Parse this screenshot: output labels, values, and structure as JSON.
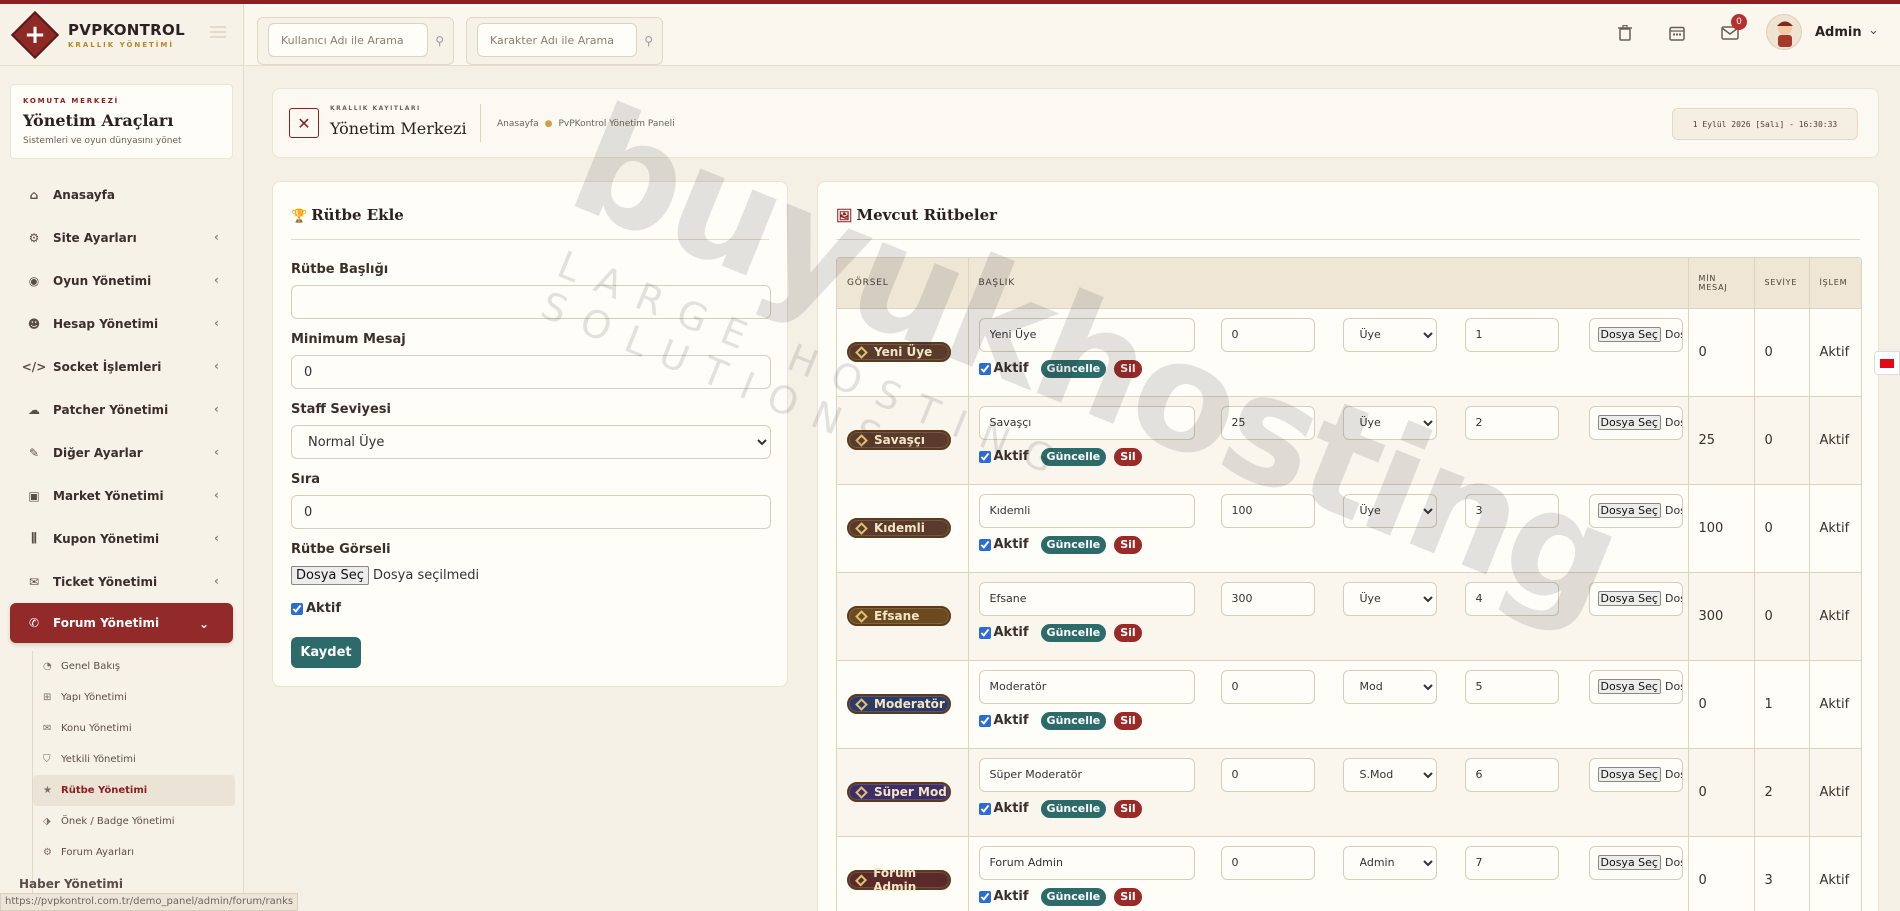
{
  "brand": {
    "name": "PVPKONTROL",
    "sub": "KRALLIK YÖNETİMİ"
  },
  "topbar": {
    "search_user_placeholder": "Kullanıcı Adı ile Arama",
    "search_char_placeholder": "Karakter Adı ile Arama",
    "mail_badge": "0",
    "admin_name": "Admin"
  },
  "sidebar": {
    "kicker": "KOMUTA MERKEZİ",
    "title": "Yönetim Araçları",
    "desc": "Sistemleri ve oyun dünyasını yönet",
    "items": [
      {
        "label": "Anasayfa",
        "icon": "home-icon"
      },
      {
        "label": "Site Ayarları",
        "icon": "gear-icon"
      },
      {
        "label": "Oyun Yönetimi",
        "icon": "gamepad-icon"
      },
      {
        "label": "Hesap Yönetimi",
        "icon": "users-icon"
      },
      {
        "label": "Socket İşlemleri",
        "icon": "code-icon"
      },
      {
        "label": "Patcher Yönetimi",
        "icon": "cloud-icon"
      },
      {
        "label": "Diğer Ayarlar",
        "icon": "wrench-icon"
      },
      {
        "label": "Market Yönetimi",
        "icon": "cart-icon"
      },
      {
        "label": "Kupon Yönetimi",
        "icon": "barcode-icon"
      },
      {
        "label": "Ticket Yönetimi",
        "icon": "ticket-icon"
      },
      {
        "label": "Forum Yönetimi",
        "icon": "comments-icon"
      }
    ],
    "sub_items": [
      {
        "label": "Genel Bakış",
        "icon": "gauge-icon"
      },
      {
        "label": "Yapı Yönetimi",
        "icon": "sitemap-icon"
      },
      {
        "label": "Konu Yönetimi",
        "icon": "comment-icon"
      },
      {
        "label": "Yetkili Yönetimi",
        "icon": "shield-icon"
      },
      {
        "label": "Rütbe Yönetimi",
        "icon": "star-icon"
      },
      {
        "label": "Önek / Badge Yönetimi",
        "icon": "tags-icon"
      },
      {
        "label": "Forum Ayarları",
        "icon": "cogs-icon"
      }
    ],
    "status_url": "https://pvpkontrol.com.tr/demo_panel/admin/forum/ranks",
    "next_item_partial": "Haber Yönetimi"
  },
  "header": {
    "kicker": "KRALLIK KAYITLARI",
    "title": "Yönetim Merkezi",
    "crumb_home": "Anasayfa",
    "crumb_current": "PvPKontrol Yönetim Paneli",
    "datetime": "1 Eylül 2026 [Salı] - 16:30:33"
  },
  "add_form": {
    "title": "Rütbe Ekle",
    "title_label": "Rütbe Başlığı",
    "title_value": "",
    "min_label": "Minimum Mesaj",
    "min_value": "0",
    "staff_label": "Staff Seviyesi",
    "staff_value": "Normal Üye",
    "order_label": "Sıra",
    "order_value": "0",
    "image_label": "Rütbe Görseli",
    "file_button": "Dosya Seç",
    "file_status": "Dosya seçilmedi",
    "active_label": "Aktif",
    "save_label": "Kaydet"
  },
  "ranks": {
    "title": "Mevcut Rütbeler",
    "headers": [
      "GÖRSEL",
      "BAŞLIK",
      "MİN MESAJ",
      "SEVİYE",
      "İŞLEM"
    ],
    "file_button": "Dosya Seç",
    "file_partial": "Dosya",
    "active_label": "Aktif",
    "update_label": "Güncelle",
    "delete_label": "Sil",
    "rows": [
      {
        "badge": "Yeni Üye",
        "color": "#5a3a2a",
        "title": "Yeni Üye",
        "min": "0",
        "staff": "Üye",
        "order": "1",
        "min_col": "0",
        "level": "0",
        "status": "Aktif"
      },
      {
        "badge": "Savaşçı",
        "color": "#5a3a2a",
        "title": "Savaşçı",
        "min": "25",
        "staff": "Üye",
        "order": "2",
        "min_col": "25",
        "level": "0",
        "status": "Aktif"
      },
      {
        "badge": "Kıdemli",
        "color": "#5a3a2a",
        "title": "Kıdemli",
        "min": "100",
        "staff": "Üye",
        "order": "3",
        "min_col": "100",
        "level": "0",
        "status": "Aktif"
      },
      {
        "badge": "Efsane",
        "color": "#6a4a1e",
        "title": "Efsane",
        "min": "300",
        "staff": "Üye",
        "order": "4",
        "min_col": "300",
        "level": "0",
        "status": "Aktif"
      },
      {
        "badge": "Moderatör",
        "color": "#2e3a66",
        "title": "Moderatör",
        "min": "0",
        "staff": "Mod",
        "order": "5",
        "min_col": "0",
        "level": "1",
        "status": "Aktif"
      },
      {
        "badge": "Süper Mod",
        "color": "#3e2e66",
        "title": "Süper Moderatör",
        "min": "0",
        "staff": "S.Mod",
        "order": "6",
        "min_col": "0",
        "level": "2",
        "status": "Aktif"
      },
      {
        "badge": "Forum Admin",
        "color": "#5a2a2a",
        "title": "Forum Admin",
        "min": "0",
        "staff": "Admin",
        "order": "7",
        "min_col": "0",
        "level": "3",
        "status": "Aktif"
      }
    ]
  },
  "watermark": {
    "big": "buyukhosting",
    "small": "LARGE HOSTING SOLUTIONS"
  }
}
